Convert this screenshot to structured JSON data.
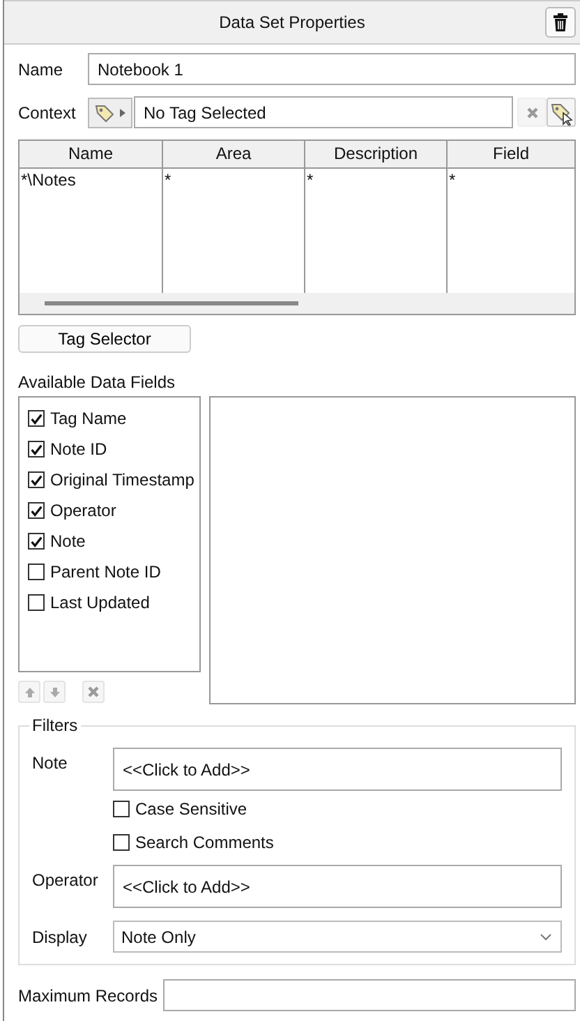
{
  "panel": {
    "title": "Data Set Properties"
  },
  "name_field": {
    "label": "Name",
    "value": "Notebook 1"
  },
  "context": {
    "label": "Context",
    "value": "No Tag Selected"
  },
  "table": {
    "columns": [
      "Name",
      "Area",
      "Description",
      "Field"
    ],
    "rows": [
      [
        "*\\Notes",
        "*",
        "*",
        "*"
      ]
    ]
  },
  "tag_selector": {
    "label": "Tag Selector"
  },
  "available_fields": {
    "label": "Available Data Fields",
    "items": [
      {
        "label": "Tag Name",
        "checked": true
      },
      {
        "label": "Note ID",
        "checked": true
      },
      {
        "label": "Original Timestamp",
        "checked": true
      },
      {
        "label": "Operator",
        "checked": true
      },
      {
        "label": "Note",
        "checked": true
      },
      {
        "label": "Parent Note ID",
        "checked": false
      },
      {
        "label": "Last Updated",
        "checked": false
      }
    ]
  },
  "filters": {
    "title": "Filters",
    "note": {
      "label": "Note",
      "value": "<<Click to Add>>"
    },
    "options": [
      {
        "label": "Case Sensitive",
        "checked": false
      },
      {
        "label": "Search Comments",
        "checked": false
      }
    ],
    "operator": {
      "label": "Operator",
      "value": "<<Click to Add>>"
    },
    "display": {
      "label": "Display",
      "value": "Note Only"
    }
  },
  "max_records": {
    "label": "Maximum Records"
  }
}
